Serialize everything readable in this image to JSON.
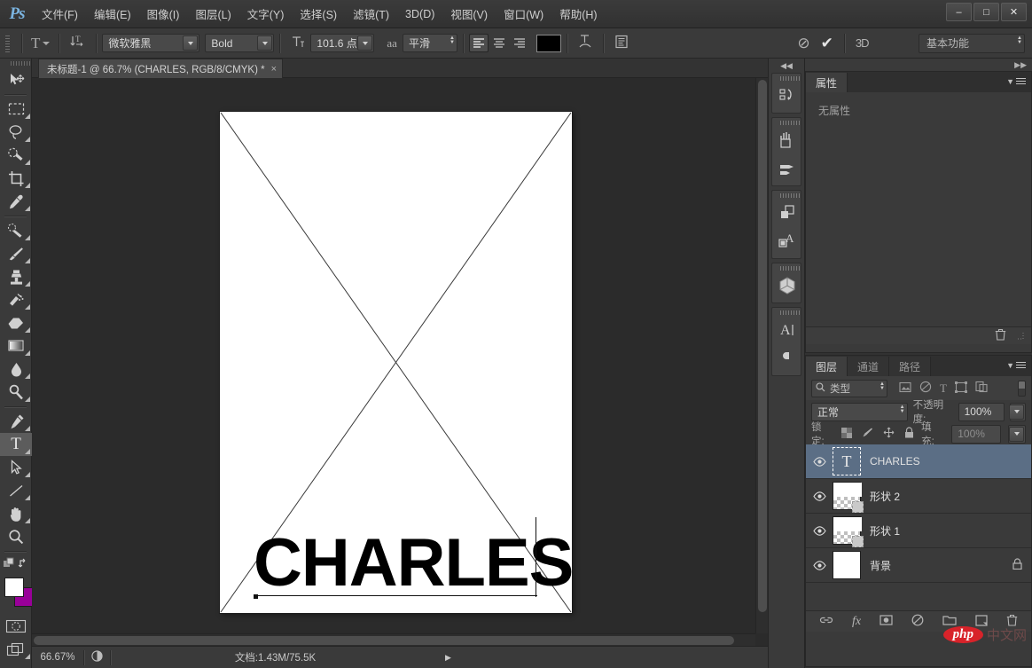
{
  "app": {
    "logo": "Ps",
    "menus": [
      {
        "label": "文件(F)"
      },
      {
        "label": "编辑(E)"
      },
      {
        "label": "图像(I)"
      },
      {
        "label": "图层(L)"
      },
      {
        "label": "文字(Y)"
      },
      {
        "label": "选择(S)"
      },
      {
        "label": "滤镜(T)"
      },
      {
        "label": "3D(D)"
      },
      {
        "label": "视图(V)"
      },
      {
        "label": "窗口(W)"
      },
      {
        "label": "帮助(H)"
      }
    ],
    "window_controls": {
      "minimize": "–",
      "maximize": "□",
      "close": "✕"
    }
  },
  "options_bar": {
    "tool_preset_label": "T",
    "orientation_icon": "text-orientation-icon",
    "font_family": "微软雅黑",
    "font_style": "Bold",
    "font_size": "101.6 点",
    "anti_alias_label": "aa",
    "anti_alias": "平滑",
    "align": [
      "align-left",
      "align-center",
      "align-right"
    ],
    "align_active": "align-left",
    "color_swatch": "#000000",
    "warp_icon": "warp-text-icon",
    "panel_icon": "character-panel-icon",
    "cancel_icon": "cancel-edit-icon",
    "commit_icon": "commit-edit-icon",
    "three_d_label": "3D",
    "workspace": "基本功能"
  },
  "document": {
    "tab_title": "未标题-1 @ 66.7% (CHARLES, RGB/8/CMYK) *",
    "close_glyph": "×",
    "canvas_text": "CHARLES"
  },
  "toolbar": {
    "tools": [
      {
        "name": "move-tool",
        "active": false,
        "has_flyout": false
      },
      {
        "name": "rectangular-marquee-tool",
        "active": false,
        "has_flyout": true
      },
      {
        "name": "lasso-tool",
        "active": false,
        "has_flyout": true
      },
      {
        "name": "quick-selection-tool",
        "active": false,
        "has_flyout": true
      },
      {
        "name": "crop-tool",
        "active": false,
        "has_flyout": true
      },
      {
        "name": "eyedropper-tool",
        "active": false,
        "has_flyout": true
      },
      {
        "name": "spot-healing-brush-tool",
        "active": false,
        "has_flyout": true
      },
      {
        "name": "brush-tool",
        "active": false,
        "has_flyout": true
      },
      {
        "name": "clone-stamp-tool",
        "active": false,
        "has_flyout": true
      },
      {
        "name": "history-brush-tool",
        "active": false,
        "has_flyout": true
      },
      {
        "name": "eraser-tool",
        "active": false,
        "has_flyout": true
      },
      {
        "name": "gradient-tool",
        "active": false,
        "has_flyout": true
      },
      {
        "name": "blur-tool",
        "active": false,
        "has_flyout": true
      },
      {
        "name": "dodge-tool",
        "active": false,
        "has_flyout": true
      },
      {
        "name": "pen-tool",
        "active": false,
        "has_flyout": true
      },
      {
        "name": "horizontal-type-tool",
        "active": true,
        "has_flyout": true
      },
      {
        "name": "path-selection-tool",
        "active": false,
        "has_flyout": true
      },
      {
        "name": "line-tool",
        "active": false,
        "has_flyout": true
      },
      {
        "name": "hand-tool",
        "active": false,
        "has_flyout": true
      },
      {
        "name": "zoom-tool",
        "active": false,
        "has_flyout": false
      }
    ],
    "foreground_color": "#ffffff",
    "background_color": "#990099",
    "quick_mask": "quick-mask-icon",
    "screen_mode": "screen-mode-icon"
  },
  "status_bar": {
    "zoom": "66.67%",
    "doc_info": "文档:1.43M/75.5K",
    "arrow": "▶"
  },
  "icon_dock": {
    "collapse": "◀◀",
    "groups": [
      {
        "icons": [
          {
            "name": "history-panel-icon"
          }
        ]
      },
      {
        "icons": [
          {
            "name": "brush-presets-panel-icon"
          },
          {
            "name": "brush-panel-icon"
          }
        ]
      },
      {
        "icons": [
          {
            "name": "layer-comps-panel-icon"
          },
          {
            "name": "character-styles-panel-icon"
          }
        ]
      },
      {
        "icons": [
          {
            "name": "3d-panel-icon"
          }
        ]
      },
      {
        "icons": [
          {
            "name": "character-panel-icon"
          },
          {
            "name": "paragraph-panel-icon"
          }
        ]
      }
    ]
  },
  "properties_panel": {
    "collapse": "▶▶",
    "tabs": [
      {
        "label": "属性",
        "active": true
      }
    ],
    "empty_text": "无属性",
    "delete_icon": "trash-icon"
  },
  "layers_panel": {
    "tabs": [
      {
        "label": "图层",
        "active": true
      },
      {
        "label": "通道",
        "active": false
      },
      {
        "label": "路径",
        "active": false
      }
    ],
    "filter": {
      "search_icon": "search-icon",
      "type_label": "类型",
      "icons": [
        {
          "name": "filter-pixel-icon"
        },
        {
          "name": "filter-adjustment-icon"
        },
        {
          "name": "filter-type-icon"
        },
        {
          "name": "filter-shape-icon"
        },
        {
          "name": "filter-smart-object-icon"
        }
      ],
      "toggle": "filter-enable-toggle"
    },
    "blend_mode": "正常",
    "opacity_label": "不透明度:",
    "opacity_value": "100%",
    "lock_label": "锁定:",
    "lock_icons": [
      {
        "name": "lock-transparency-icon"
      },
      {
        "name": "lock-image-icon"
      },
      {
        "name": "lock-position-icon"
      },
      {
        "name": "lock-all-icon"
      }
    ],
    "fill_label": "填充:",
    "fill_value": "100%",
    "layers": [
      {
        "name": "CHARLES",
        "type": "text",
        "selected": true,
        "visible": true,
        "locked": false
      },
      {
        "name": "形状 2",
        "type": "shape",
        "selected": false,
        "visible": true,
        "locked": false
      },
      {
        "name": "形状 1",
        "type": "shape",
        "selected": false,
        "visible": true,
        "locked": false
      },
      {
        "name": "背景",
        "type": "background",
        "selected": false,
        "visible": true,
        "locked": true
      }
    ],
    "footer_icons": [
      {
        "name": "link-layers-icon"
      },
      {
        "name": "layer-style-fx-icon"
      },
      {
        "name": "layer-mask-icon"
      },
      {
        "name": "adjustment-layer-icon"
      },
      {
        "name": "new-group-icon"
      },
      {
        "name": "new-layer-icon"
      },
      {
        "name": "delete-layer-icon"
      }
    ]
  },
  "watermark": {
    "badge": "php",
    "text": "中文网"
  }
}
